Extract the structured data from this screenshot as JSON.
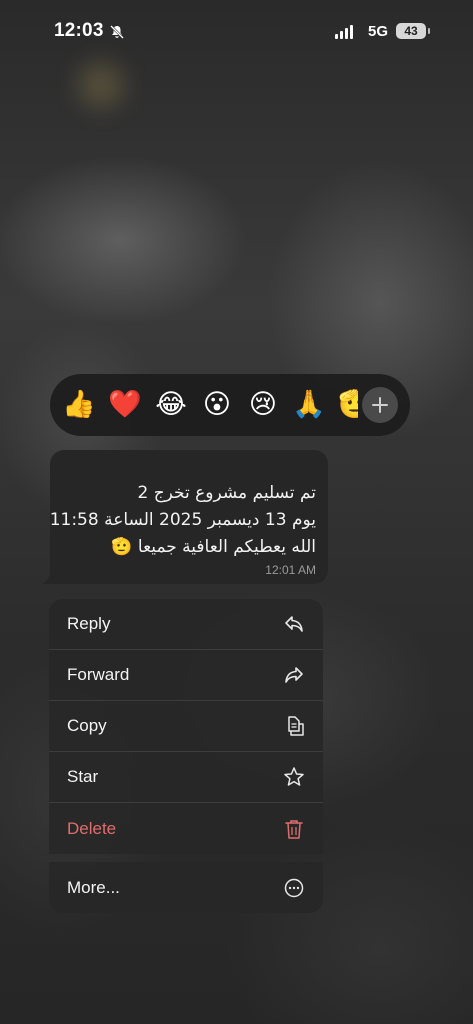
{
  "status_bar": {
    "time": "12:03",
    "network": "5G",
    "battery": "43"
  },
  "reactions": [
    {
      "emoji": "👍",
      "name": "thumbs-up"
    },
    {
      "emoji": "❤️",
      "name": "heart"
    },
    {
      "emoji": "😂",
      "name": "tears-of-joy"
    },
    {
      "emoji": "😮",
      "name": "surprised"
    },
    {
      "emoji": "😢",
      "name": "crying"
    },
    {
      "emoji": "🙏",
      "name": "pray"
    },
    {
      "emoji": "🫡",
      "name": "partial"
    }
  ],
  "message": {
    "lines": [
      "تم تسليم مشروع تخرج 2",
      "يوم 13 ديسمبر 2025 الساعة 11:58",
      "الله يعطيكم العافية جميعا 🫡"
    ],
    "time": "12:01 AM"
  },
  "menu": {
    "items": [
      {
        "label": "Reply",
        "icon": "reply-icon"
      },
      {
        "label": "Forward",
        "icon": "forward-icon"
      },
      {
        "label": "Copy",
        "icon": "copy-icon"
      },
      {
        "label": "Star",
        "icon": "star-icon"
      },
      {
        "label": "Delete",
        "icon": "trash-icon",
        "color": "#e06d6d"
      }
    ],
    "more_label": "More..."
  }
}
